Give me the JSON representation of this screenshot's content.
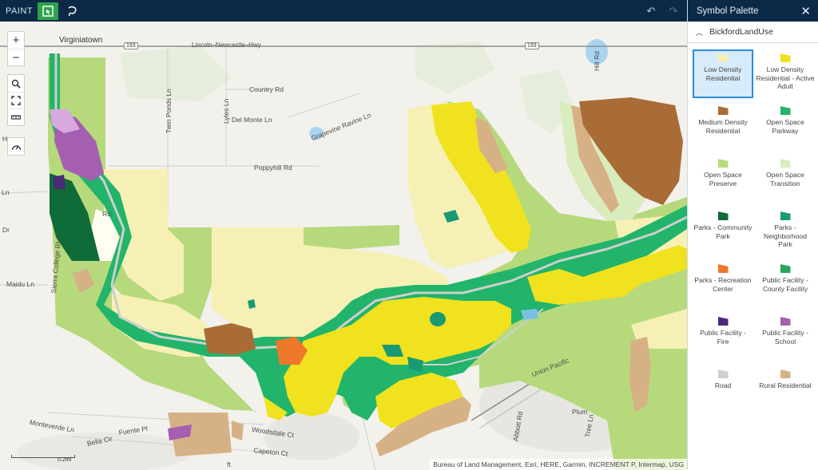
{
  "toolbar": {
    "mode_label": "PAINT",
    "select_tool_icon": "select-area-icon",
    "lasso_tool_icon": "lasso-icon",
    "undo_icon": "undo-icon",
    "redo_icon": "redo-icon"
  },
  "panel": {
    "title": "Symbol Palette",
    "close_icon": "close-icon",
    "layer_name": "BickfordLandUse",
    "symbols": [
      {
        "label": "Low Density Residential",
        "color": "#f6f0b4",
        "selected": true
      },
      {
        "label": "Low Density Residential - Active Adult",
        "color": "#f0e21e",
        "selected": false
      },
      {
        "label": "Medium Density Residential",
        "color": "#a96c37",
        "selected": false
      },
      {
        "label": "Open Space Parkway",
        "color": "#22b46a",
        "selected": false
      },
      {
        "label": "Open Space Preserve",
        "color": "#b6d97c",
        "selected": false
      },
      {
        "label": "Open Space Transition",
        "color": "#d9ecbd",
        "selected": false
      },
      {
        "label": "Parks - Community Park",
        "color": "#0f6b37",
        "selected": false
      },
      {
        "label": "Parks - Neighborhood Park",
        "color": "#1a9a73",
        "selected": false
      },
      {
        "label": "Parks - Recreation Center",
        "color": "#f0782a",
        "selected": false
      },
      {
        "label": "Public Facility - County Facility",
        "color": "#27a85a",
        "selected": false
      },
      {
        "label": "Public Facility - Fire",
        "color": "#4a2a78",
        "selected": false
      },
      {
        "label": "Public Facility - School",
        "color": "#a45fb0",
        "selected": false
      },
      {
        "label": "Road",
        "color": "#cfcfcf",
        "selected": false
      },
      {
        "label": "Rural Residential",
        "color": "#d7b186",
        "selected": false
      }
    ]
  },
  "map": {
    "controls": {
      "zoom_in": "+",
      "zoom_out": "−",
      "search_icon": "search-icon",
      "full_extent_icon": "expand-icon",
      "measure_icon": "measure-icon",
      "gauge_icon": "gauge-icon"
    },
    "labels": {
      "virginiatown": "Virginiatown",
      "shield_193a": "193",
      "shield_193b": "193",
      "lincoln_hwy": "Lincoln–Newcastle–Hwy",
      "country_rd": "Country Rd",
      "del_monte": "Del Monte Ln",
      "twin_ponds": "Twin Ponds Ln",
      "lyles": "Lyles Ln",
      "grapevine": "Grapevine Ravine Ln",
      "poppyhill": "Poppyhill Rd",
      "hill_rd": "Hill Rd",
      "ln_left": "Ln",
      "dr_left": "Dr",
      "he_left": "He",
      "maidu": "Maidu Ln",
      "sierra": "Sierra College Blvd",
      "rd_small": "Rd",
      "union_pacific": "Union Pacific",
      "woodsdale": "Woodsdale Ct",
      "monteverde": "Monteverde Ln",
      "bella": "Bella Cir",
      "fuente": "Fuente Pl",
      "capeton": "Capeton Ct",
      "plum": "Plum",
      "tree": "Tree Ln",
      "abbott": "Abbott Rd",
      "ft": "ft"
    },
    "scale_label": "0.2mi",
    "attribution": "Bureau of Land Management, Esri, HERE, Garmin, INCREMENT P, Intermap, USG"
  },
  "colors": {
    "topbar": "#0c2a48",
    "accent_green": "#2ea34a",
    "selection_blue": "#2a8bd6"
  }
}
